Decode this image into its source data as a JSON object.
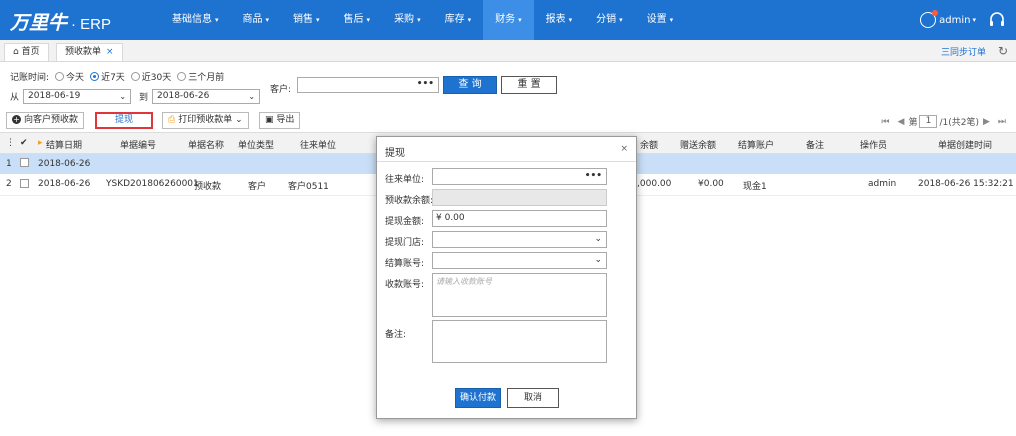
{
  "app": {
    "logo": "万里牛",
    "logo_suffix": "· ERP"
  },
  "nav": [
    {
      "label": "基础信息"
    },
    {
      "label": "商品"
    },
    {
      "label": "销售"
    },
    {
      "label": "售后"
    },
    {
      "label": "采购"
    },
    {
      "label": "库存"
    },
    {
      "label": "财务",
      "active": true
    },
    {
      "label": "报表"
    },
    {
      "label": "分销"
    },
    {
      "label": "设置"
    }
  ],
  "user": {
    "name": "admin"
  },
  "tabs": {
    "home": "首页",
    "current": "预收款单",
    "close": "×"
  },
  "sync_label": "三同步订单",
  "filter": {
    "date_label": "记账时间:",
    "opt_today": "今天",
    "opt_7d": "近7天",
    "opt_30d": "近30天",
    "opt_3m": "三个月前",
    "from_label": "从",
    "from_date": "2018-06-19",
    "to_label": "到",
    "to_date": "2018-06-26",
    "customer_label": "客户:",
    "query": "查 询",
    "reset": "重 置"
  },
  "toolbar": {
    "to_customer": "向客户预收款",
    "withdraw": "提现",
    "print": "打印预收款单",
    "export": "导出"
  },
  "pager": {
    "page_prefix": "第",
    "page": "1",
    "total": "/1(共2笔)"
  },
  "grid": {
    "headers": {
      "settle_date": "结算日期",
      "doc_no": "单据编号",
      "doc_name": "单据名称",
      "unit_type": "单位类型",
      "partner": "往来单位",
      "balance": "余额",
      "gift_balance": "赠送余额",
      "account": "结算账户",
      "remark": "备注",
      "operator": "操作员",
      "created": "单据创建时间"
    },
    "group_row": {
      "num": "1",
      "date": "2018-06-26"
    },
    "row": {
      "num": "2",
      "date": "2018-06-26",
      "doc_no": "YSKD201806260001",
      "doc_name": "预收款",
      "unit_type": "客户",
      "partner": "客户0511",
      "balance": ",000.00",
      "gift_balance": "¥0.00",
      "account": "现金1",
      "remark": "",
      "operator": "admin",
      "created": "2018-06-26 15:32:21"
    }
  },
  "modal": {
    "title": "提现",
    "close": "×",
    "partner_label": "往来单位:",
    "balance_label": "预收款余额:",
    "amount_label": "提现金额:",
    "amount_value": "¥ 0.00",
    "store_label": "提现门店:",
    "account_label": "结算账号:",
    "receive_label": "收款账号:",
    "receive_placeholder": "请输入收款账号",
    "remark_label": "备注:",
    "confirm": "确认付款",
    "cancel": "取消"
  },
  "colors": {
    "brand": "#1f73d0",
    "highlight_border": "#e0363a",
    "selected_row": "#c9dff7"
  }
}
